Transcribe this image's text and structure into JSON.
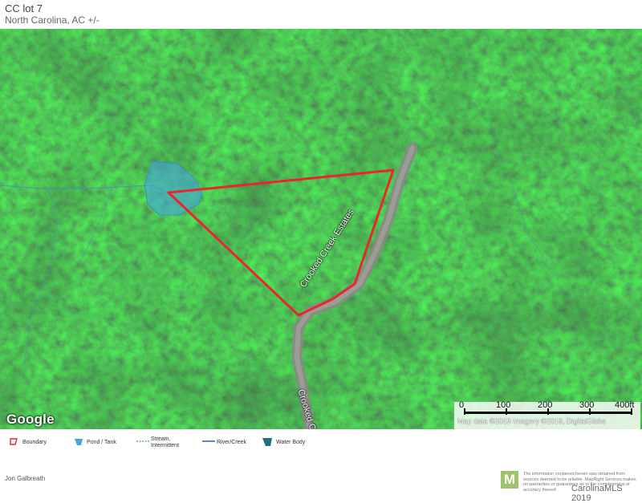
{
  "header": {
    "title": "CC lot 7",
    "subtitle": "North Carolina,  AC +/-"
  },
  "map": {
    "labels": {
      "road_main": "Crooked Creek Estates",
      "road_lower": "Crooked C"
    },
    "google_logo": "Google",
    "scale": {
      "ticks": [
        "0",
        "100",
        "200",
        "300",
        "400ft"
      ],
      "credit": "Map data ©2019  Imagery ©2019, DigitalGlobe"
    },
    "colors": {
      "boundary": "#e8262b",
      "pond": "#45a6d8",
      "road": "#8a8a85"
    }
  },
  "legend": {
    "items": [
      {
        "label": "Boundary",
        "icon": "boundary-icon"
      },
      {
        "label": "Pond / Tank",
        "icon": "pond-icon"
      },
      {
        "label": "Stream, Intermittent",
        "icon": "stream-icon"
      },
      {
        "label": "River/Creek",
        "icon": "river-icon"
      },
      {
        "label": "Water Body",
        "icon": "water-body-icon"
      }
    ]
  },
  "footer": {
    "agent": "Jon Galbreath",
    "logo_letter": "M",
    "disclaimer": "The information contained herein was obtained from sources deemed to be reliable. MapRight Services makes no warranties or guarantees as to the completeness or accuracy thereof.",
    "watermark": "CarolinaMLS 2019"
  }
}
